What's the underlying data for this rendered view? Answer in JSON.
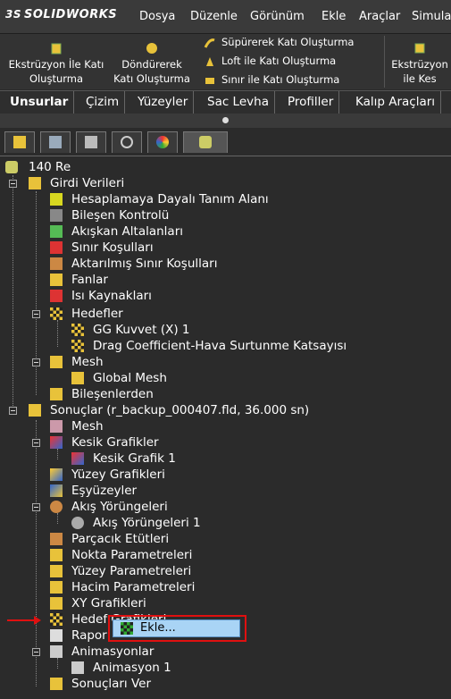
{
  "app": {
    "logo": "SOLIDWORKS",
    "logo_mark": "3S"
  },
  "menu": [
    "Dosya",
    "Düzenle",
    "Görünüm",
    "Ekle",
    "Araçlar",
    "Simula"
  ],
  "ribbon": {
    "extrude_boss": "Ekstrüzyon İle Katı Oluşturma",
    "revolve_boss": "Döndürerek Katı Oluşturma",
    "sweep_boss": "Süpürerek Katı Oluşturma",
    "loft_boss": "Loft ile Katı Oluşturma",
    "boundary_boss": "Sınır ile Katı Oluşturma",
    "extrude_cut": "Ekstrüzyon ile Kes"
  },
  "tabs": [
    "Unsurlar",
    "Çizim",
    "Yüzeyler",
    "Sac Levha",
    "Profiller",
    "Kalıp Araçları"
  ],
  "tree": {
    "root": "140 Re",
    "input": "Girdi Verileri",
    "input_items": [
      "Hesaplamaya Dayalı Tanım Alanı",
      "Bileşen Kontrolü",
      "Akışkan Altalanları",
      "Sınır Koşulları",
      "Aktarılmış Sınır Koşulları",
      "Fanlar",
      "Isı Kaynakları"
    ],
    "goals": "Hedefler",
    "goal_items": [
      "GG Kuvvet (X) 1",
      "Drag Coefficient-Hava Surtunme Katsayısı"
    ],
    "mesh": "Mesh",
    "global_mesh": "Global Mesh",
    "components": "Bileşenlerden",
    "results": "Sonuçlar (r_backup_000407.fld, 36.000 sn)",
    "results_mesh": "Mesh",
    "cut_plots": "Kesik Grafikler",
    "cut_plot_1": "Kesik Grafik 1",
    "surface_plots": "Yüzey Grafikleri",
    "isosurfaces": "Eşyüzeyler",
    "flow_traj": "Akış Yörüngeleri",
    "flow_traj_1": "Akış Yörüngeleri 1",
    "particle": "Parçacık Etütleri",
    "point_params": "Nokta Parametreleri",
    "surface_params": "Yüzey Parametreleri",
    "volume_params": "Hacim Parametreleri",
    "xy_plots": "XY Grafikleri",
    "goal_plots": "Hedef Grafikleri",
    "report": "Rapor",
    "animations": "Animasyonlar",
    "animation_1": "Animasyon 1",
    "export_results": "Sonuçları Ver"
  },
  "context_menu": {
    "add": "Ekle..."
  },
  "colors": {
    "highlight": "#a9d4f5",
    "annotation_red": "#e01010",
    "background": "#2b2b2b"
  }
}
